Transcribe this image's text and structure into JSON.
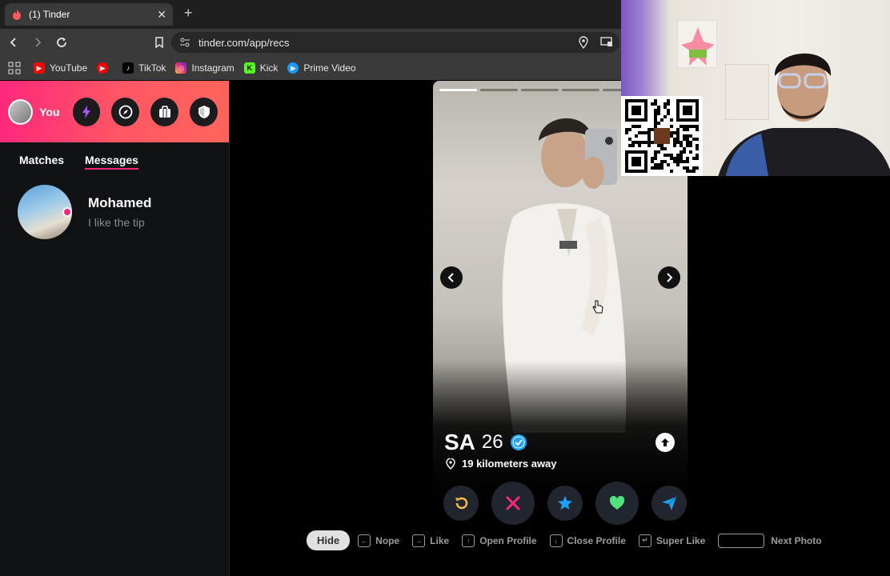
{
  "browser": {
    "tab_title": "(1) Tinder",
    "url": "tinder.com/app/recs",
    "bookmarks": [
      {
        "label": "YouTube",
        "icon": "youtube-icon",
        "color": "#ff0000"
      },
      {
        "label": "",
        "icon": "youtube-icon",
        "color": "#ff0000"
      },
      {
        "label": "TikTok",
        "icon": "tiktok-icon",
        "color": "#000000"
      },
      {
        "label": "Instagram",
        "icon": "instagram-icon",
        "color": "#e1306c"
      },
      {
        "label": "Kick",
        "icon": "kick-icon",
        "color": "#53fc18"
      },
      {
        "label": "Prime Video",
        "icon": "prime-video-icon",
        "color": "#1a98ff"
      }
    ]
  },
  "sidebar": {
    "you_label": "You",
    "tabs": [
      {
        "label": "Matches",
        "active": false
      },
      {
        "label": "Messages",
        "active": true
      }
    ],
    "conversations": [
      {
        "name": "Mohamed",
        "preview": "I like the tip"
      }
    ]
  },
  "card": {
    "name": "SA",
    "age": "26",
    "verified": true,
    "distance": "19 kilometers away",
    "photo_count": 6,
    "photo_index": 1
  },
  "actions": [
    {
      "name": "rewind",
      "icon": "rewind-icon",
      "color": "#f5b748"
    },
    {
      "name": "nope",
      "icon": "close-icon",
      "color": "#fd267a"
    },
    {
      "name": "super-like",
      "icon": "star-icon",
      "color": "#1da1f2"
    },
    {
      "name": "like",
      "icon": "heart-icon",
      "color": "#4fe27d"
    },
    {
      "name": "boost",
      "icon": "send-icon",
      "color": "#1da1f2"
    }
  ],
  "shortcuts": {
    "hide_label": "Hide",
    "items": [
      {
        "label": "Nope",
        "key": "←"
      },
      {
        "label": "Like",
        "key": "→"
      },
      {
        "label": "Open Profile",
        "key": "↑"
      },
      {
        "label": "Close Profile",
        "key": "↓"
      },
      {
        "label": "Super Like",
        "key": "↵"
      }
    ],
    "next_photo_label": "Next Photo"
  },
  "colors": {
    "brand_gradient_start": "#fd297b",
    "brand_gradient_end": "#ff655b",
    "accent_pink": "#fd267a"
  }
}
